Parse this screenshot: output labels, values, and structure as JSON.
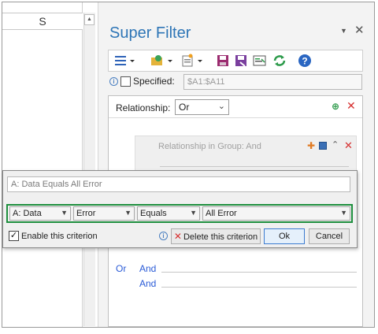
{
  "sheet": {
    "column_header": "S"
  },
  "pane": {
    "title": "Super Filter",
    "specified_label": "Specified:",
    "specified_value": "$A1:$A11",
    "relationship_label": "Relationship:",
    "relationship_value": "Or",
    "group_label": "Relationship in Group:  And",
    "or_label": "Or",
    "and_labels": [
      "And",
      "And"
    ]
  },
  "toolbar": {
    "icons": [
      "menu-icon",
      "open-scenario-icon",
      "new-scenario-icon",
      "save-icon",
      "save-as-icon",
      "export-icon",
      "refresh-icon",
      "help-icon"
    ]
  },
  "dialog": {
    "summary": "A: Data  Equals  All Error",
    "column_select": "A: Data",
    "type_select": "Error",
    "operator_select": "Equals",
    "value_select": "All Error",
    "enable_label": "Enable this criterion",
    "delete_label": "Delete this criterion",
    "ok_label": "Ok",
    "cancel_label": "Cancel"
  },
  "colors": {
    "title_blue": "#2e75b6",
    "highlight_green": "#1e8f3e",
    "link_blue": "#2a5bd7",
    "delete_red": "#d63030"
  }
}
